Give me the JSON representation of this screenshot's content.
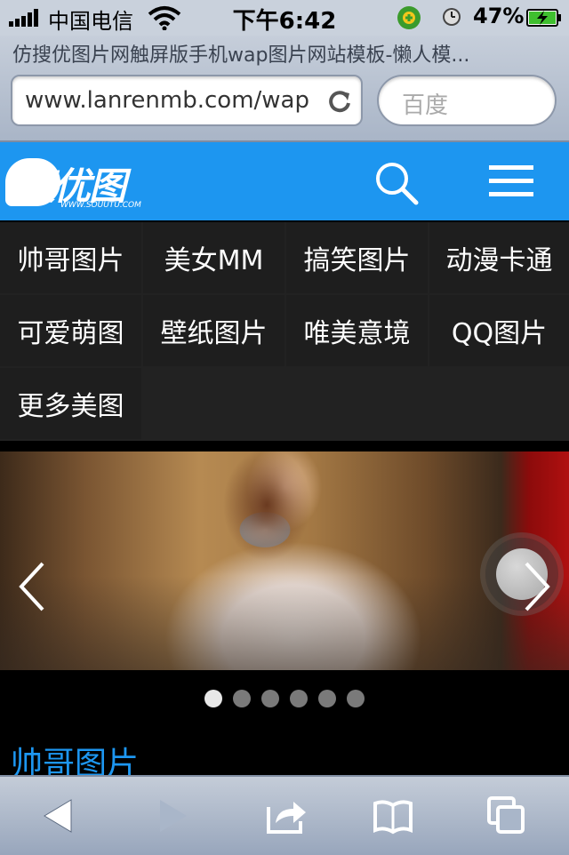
{
  "status_bar": {
    "carrier": "中国电信",
    "time": "下午6:42",
    "battery_percent": "47%"
  },
  "browser": {
    "page_title": "仿搜优图片网触屏版手机wap图片网站模板-懒人模...",
    "url": "www.lanrenmb.com/wap",
    "search_placeholder": "百度"
  },
  "header": {
    "logo_text": "搜优图",
    "logo_url_text": "WWW.SOUUTU.COM",
    "accent_color": "#1d96f0"
  },
  "categories": [
    {
      "label": "帅哥图片"
    },
    {
      "label": "美女MM"
    },
    {
      "label": "搞笑图片"
    },
    {
      "label": "动漫卡通"
    },
    {
      "label": "可爱萌图"
    },
    {
      "label": "壁纸图片"
    },
    {
      "label": "唯美意境"
    },
    {
      "label": "QQ图片"
    },
    {
      "label": "更多美图"
    }
  ],
  "carousel": {
    "slide_count": 6,
    "active_index": 0
  },
  "section": {
    "title": "帅哥图片"
  },
  "toolbar": {
    "icons": [
      "back-icon",
      "forward-icon",
      "share-icon",
      "bookmarks-icon",
      "tabs-icon"
    ]
  }
}
